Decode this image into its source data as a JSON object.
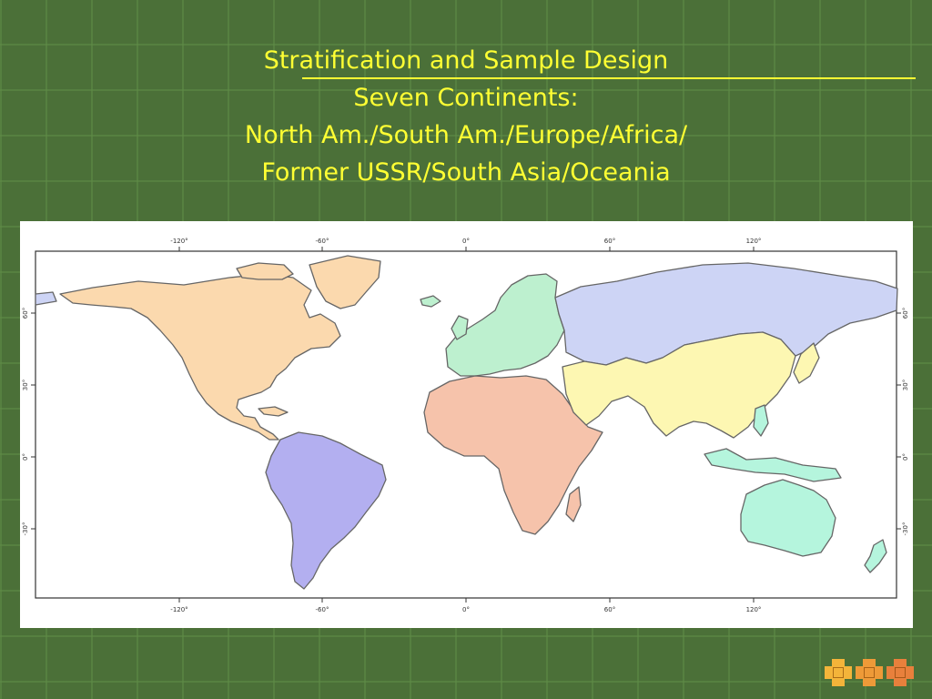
{
  "slide": {
    "title": "Stratification and Sample Design",
    "subtitle_lines": [
      "Seven Continents:",
      "North Am./South Am./Europe/Africa/",
      "Former USSR/South Asia/Oceania"
    ]
  },
  "map": {
    "x_tick_labels": [
      "-120°",
      "-60°",
      "0°",
      "60°",
      "120°"
    ],
    "y_tick_labels": [
      "60°",
      "30°",
      "0°",
      "-30°"
    ],
    "regions": [
      {
        "name": "north-america",
        "color": "#fbd9ae"
      },
      {
        "name": "south-america",
        "color": "#b3aff0"
      },
      {
        "name": "europe",
        "color": "#bdf0cf"
      },
      {
        "name": "africa",
        "color": "#f6c3ab"
      },
      {
        "name": "former-ussr",
        "color": "#cdd4f5"
      },
      {
        "name": "south-asia",
        "color": "#fdf7b2"
      },
      {
        "name": "oceania",
        "color": "#b5f5dd"
      }
    ]
  },
  "decorations": [
    {
      "name": "deco-cross-1",
      "color": "#f3b43a"
    },
    {
      "name": "deco-cross-2",
      "color": "#ee9a38"
    },
    {
      "name": "deco-cross-3",
      "color": "#e8803c"
    }
  ]
}
